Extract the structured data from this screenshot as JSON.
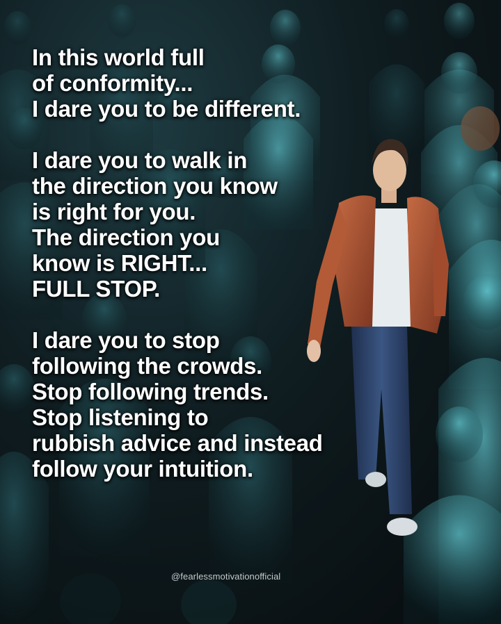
{
  "quote": {
    "paragraphs": [
      {
        "lines": [
          "In this world full",
          "of conformity...",
          "I dare you to be different."
        ]
      },
      {
        "lines": [
          "I dare you to walk in",
          "the direction you know",
          "is right for you.",
          "The direction you",
          "know is RIGHT...",
          "FULL STOP."
        ]
      },
      {
        "lines": [
          "I dare you to stop",
          "following the crowds.",
          "Stop following trends.",
          "Stop listening to",
          "rubbish advice and instead",
          "follow your intuition."
        ]
      }
    ]
  },
  "watermark": "@fearlessmotivationofficial",
  "colors": {
    "crowd_glow": "#5fd3e0",
    "jacket": "#a8502f",
    "jeans": "#2b3f63",
    "text": "#ffffff"
  }
}
